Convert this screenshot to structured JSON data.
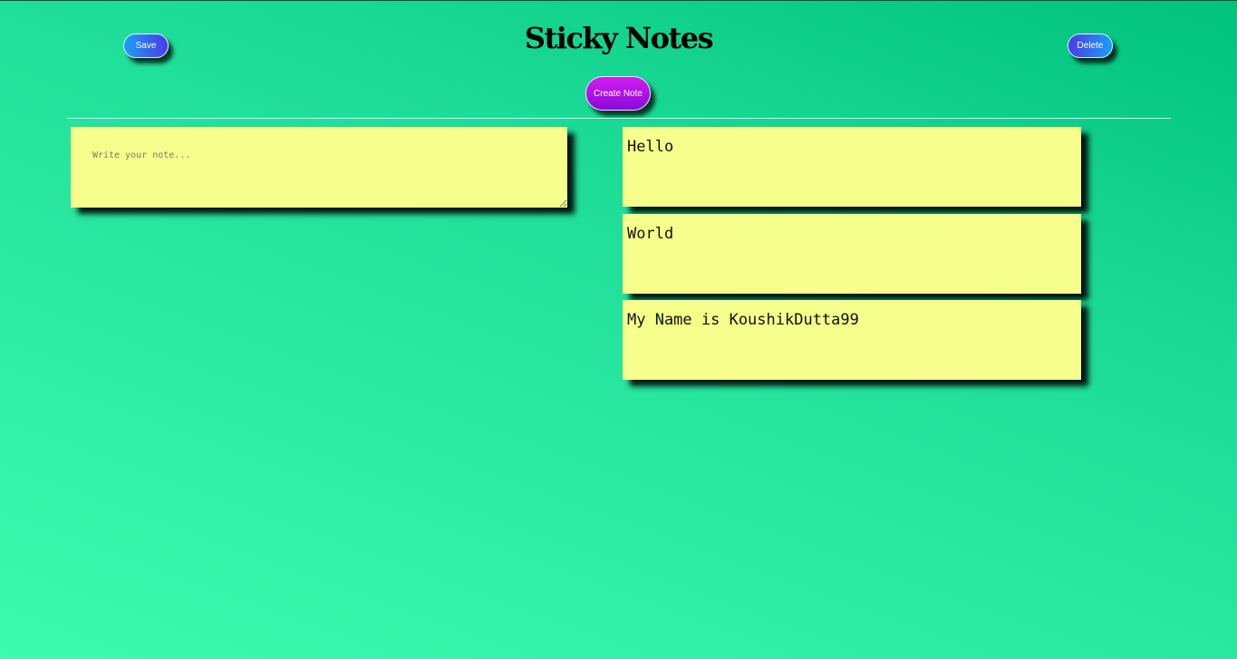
{
  "header": {
    "title": "Sticky Notes",
    "save_label": "Save",
    "delete_label": "Delete",
    "create_label": "Create Note"
  },
  "editor": {
    "placeholder": "Write your note..."
  },
  "notes": [
    {
      "text": "Hello"
    },
    {
      "text": "World"
    },
    {
      "text": "My Name is KoushikDutta99"
    }
  ],
  "colors": {
    "note_background": "#f6ff8b",
    "background_light": "#3dfbb0",
    "background_dark": "#00c27c",
    "save_button_gradient": [
      "#1aa0f6",
      "#4b3ae6"
    ],
    "create_button_gradient": [
      "#d31cf2",
      "#8a0ad8"
    ]
  }
}
